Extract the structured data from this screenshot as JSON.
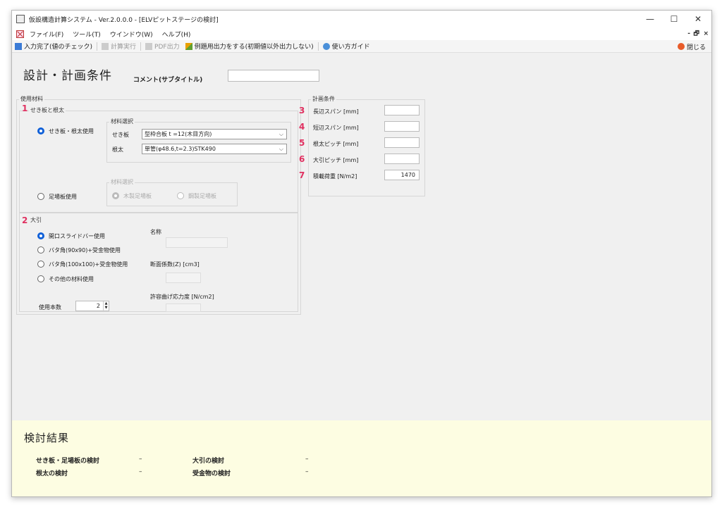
{
  "window": {
    "title": "仮設構造計算システム - Ver.2.0.0.0 - [ELVピットステージの検討]",
    "min": "—",
    "max": "☐",
    "close": "✕"
  },
  "menu": {
    "items": [
      "ファイル(F)",
      "ツール(T)",
      "ウインドウ(W)",
      "ヘルプ(H)"
    ],
    "mdi_min": "-",
    "mdi_restore": "🗗",
    "mdi_close": "×"
  },
  "toolbar": {
    "input_done": "入力完了(値のチェック)",
    "calc": "計算実行",
    "pdf": "PDF出力",
    "example": "例題用出力をする(初期値以外出力しない)",
    "guide": "使い方ガイド",
    "close": "閉じる"
  },
  "header": {
    "title": "設計・計画条件",
    "comment_label": "コメント(サブタイトル)",
    "comment_value": ""
  },
  "materials": {
    "label": "使用材料",
    "sheathing": {
      "badge": "1",
      "label": "せき板と根太",
      "opt_use": "せき板・根太使用",
      "select_group": "材料選択",
      "sekiita_label": "せき板",
      "sekiita_value": "型枠合板 t =12(木目方向)",
      "neda_label": "根太",
      "neda_value": "単管(φ48.6,t=2.3)STK490",
      "opt_scaffold": "足場板使用",
      "scaffold_group": "材料選択",
      "scaffold_wood": "木製足場板",
      "scaffold_steel": "鋼製足場板"
    },
    "beam": {
      "badge": "2",
      "label": "大引",
      "opt1": "開口スライドバー使用",
      "opt2": "バタ角(90x90)+受金物使用",
      "opt3": "バタ角(100x100)+受金物使用",
      "opt4": "その他の材料使用",
      "name_label": "名称",
      "modulus_label": "断面係数(Z) [cm3]",
      "stress_label": "許容曲げ応力度 [N/cm2]",
      "count_label": "使用本数",
      "count_value": "2"
    }
  },
  "plan": {
    "label": "計画条件",
    "rows": [
      {
        "badge": "3",
        "label": "長辺スパン [mm]",
        "value": ""
      },
      {
        "badge": "4",
        "label": "短辺スパン [mm]",
        "value": ""
      },
      {
        "badge": "5",
        "label": "根太ピッチ [mm]",
        "value": ""
      },
      {
        "badge": "6",
        "label": "大引ピッチ [mm]",
        "value": ""
      },
      {
        "badge": "7",
        "label": "積載荷重 [N/m2]",
        "value": "1470"
      }
    ]
  },
  "results": {
    "title": "検討結果",
    "r1_label": "せき板・足場板の検討",
    "r1_value": "–",
    "r2_label": "大引の検討",
    "r2_value": "–",
    "r3_label": "根太の検討",
    "r3_value": "–",
    "r4_label": "受金物の検討",
    "r4_value": "–"
  },
  "colors": {
    "accent": "#1060d8",
    "badge": "#e03060",
    "results_bg": "#fdfde2"
  }
}
